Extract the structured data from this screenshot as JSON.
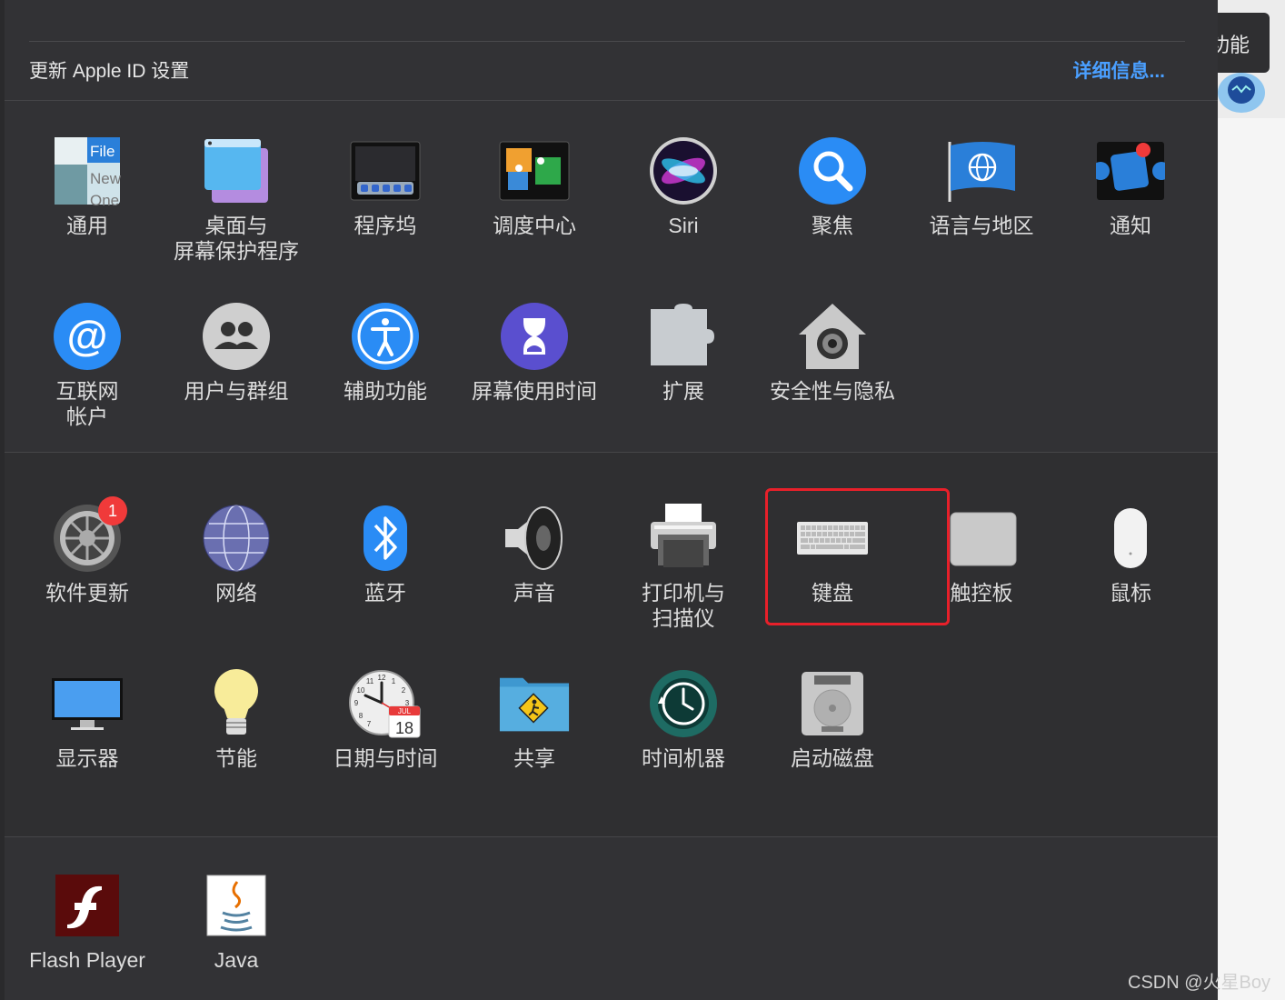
{
  "header": {
    "title": "更新 Apple ID 设置",
    "link": "详细信息..."
  },
  "row1": [
    {
      "label": "通用",
      "icon": "general-icon"
    },
    {
      "label": "桌面与\n屏幕保护程序",
      "icon": "desktop-screensaver-icon"
    },
    {
      "label": "程序坞",
      "icon": "dock-icon"
    },
    {
      "label": "调度中心",
      "icon": "mission-control-icon"
    },
    {
      "label": "Siri",
      "icon": "siri-icon"
    },
    {
      "label": "聚焦",
      "icon": "spotlight-icon"
    },
    {
      "label": "语言与地区",
      "icon": "language-region-icon"
    },
    {
      "label": "通知",
      "icon": "notifications-icon"
    }
  ],
  "row2": [
    {
      "label": "互联网\n帐户",
      "icon": "internet-accounts-icon"
    },
    {
      "label": "用户与群组",
      "icon": "users-groups-icon"
    },
    {
      "label": "辅助功能",
      "icon": "accessibility-icon"
    },
    {
      "label": "屏幕使用时间",
      "icon": "screen-time-icon"
    },
    {
      "label": "扩展",
      "icon": "extensions-icon"
    },
    {
      "label": "安全性与隐私",
      "icon": "security-privacy-icon"
    }
  ],
  "row3": [
    {
      "label": "软件更新",
      "icon": "software-update-icon",
      "badge": "1"
    },
    {
      "label": "网络",
      "icon": "network-icon"
    },
    {
      "label": "蓝牙",
      "icon": "bluetooth-icon"
    },
    {
      "label": "声音",
      "icon": "sound-icon"
    },
    {
      "label": "打印机与\n扫描仪",
      "icon": "printers-scanners-icon"
    },
    {
      "label": "键盘",
      "icon": "keyboard-icon"
    },
    {
      "label": "触控板",
      "icon": "trackpad-icon"
    },
    {
      "label": "鼠标",
      "icon": "mouse-icon"
    }
  ],
  "row4": [
    {
      "label": "显示器",
      "icon": "displays-icon"
    },
    {
      "label": "节能",
      "icon": "energy-saver-icon"
    },
    {
      "label": "日期与时间",
      "icon": "date-time-icon",
      "cal_month": "JUL",
      "cal_day": "18"
    },
    {
      "label": "共享",
      "icon": "sharing-icon"
    },
    {
      "label": "时间机器",
      "icon": "time-machine-icon"
    },
    {
      "label": "启动磁盘",
      "icon": "startup-disk-icon"
    }
  ],
  "row5": [
    {
      "label": "Flash Player",
      "icon": "flash-player-icon"
    },
    {
      "label": "Java",
      "icon": "java-icon"
    }
  ],
  "general_icon_text": [
    "File",
    "New",
    "One"
  ],
  "clock_numbers": [
    "12",
    "11",
    "1",
    "10",
    "2",
    "9",
    "3",
    "8",
    "7"
  ],
  "right_panel": {
    "tab_text": "功能"
  },
  "watermark": "CSDN @火星Boy",
  "colors": {
    "panel_bg": "#323235",
    "link": "#4a9fff",
    "highlight": "#e8202a",
    "badge": "#f03a3a"
  }
}
